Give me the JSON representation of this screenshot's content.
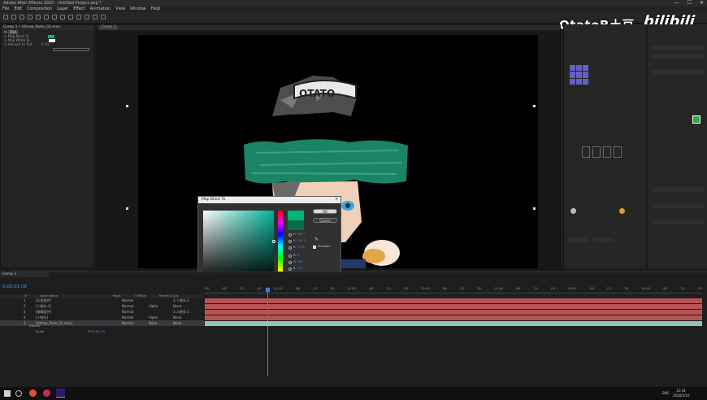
{
  "window": {
    "title": "Adobe After Effects 2020 - Untitled Project.aep *",
    "controls": [
      "—",
      "☐",
      "✕"
    ]
  },
  "menu": [
    "File",
    "Edit",
    "Composition",
    "Layer",
    "Effect",
    "Animation",
    "View",
    "Window",
    "Help"
  ],
  "viewer_tab": "Comp 1",
  "project_panel": {
    "header": "Comp 1 • Ultraw_Pude_02.mov",
    "effect": "Tint",
    "rows": [
      "Map Black To",
      "Map White To",
      "Amount to Tint"
    ],
    "value": "0.0%"
  },
  "watermark": {
    "channel": "OtatoB土豆",
    "site": "bilibili"
  },
  "dialog": {
    "title": "Map Black To",
    "ok": "OK",
    "cancel": "Cancel",
    "fields": [
      {
        "label": "H",
        "value": "163 °"
      },
      {
        "label": "S",
        "value": "100 %"
      },
      {
        "label": "B",
        "value": "71 %"
      },
      {
        "label": "R",
        "value": "0"
      },
      {
        "label": "G",
        "value": "181"
      },
      {
        "label": "B",
        "value": "120"
      }
    ],
    "hex": "00B578",
    "checkbox_label": "Previous",
    "colors": {
      "new": "#00b578",
      "old": "#0a6b4a"
    }
  },
  "timeline": {
    "timecode": "0:00:01:08",
    "col_headers": [
      "#",
      "Layer Name",
      "Mode",
      "T TrkMat",
      "Parent & Link"
    ],
    "layers": [
      {
        "num": "1",
        "name": "[头发组件]",
        "mode": "Normal",
        "trk": "",
        "parent": "3.人物头-2"
      },
      {
        "num": "2",
        "name": "[人物头-2]",
        "mode": "Normal",
        "trk": "Alpha",
        "parent": "None"
      },
      {
        "num": "3",
        "name": "[眼睛组件]",
        "mode": "Normal",
        "trk": "",
        "parent": "3.人物头-2"
      },
      {
        "num": "4",
        "name": "[人物头]",
        "mode": "Normal",
        "trk": "Alpha",
        "parent": "None"
      },
      {
        "num": "5",
        "name": "[Ultraw_Pude_02.mov]",
        "mode": "Normal",
        "trk": "None",
        "parent": "None"
      }
    ],
    "sublabels": [
      "Effects",
      "Scale"
    ],
    "scale_value": "83.0,83.0%",
    "ruler": [
      "00f",
      "06f",
      "12f",
      "18f",
      "01:00f",
      "06f",
      "12f",
      "18f",
      "02:00f",
      "06f",
      "12f",
      "18f",
      "03:00f",
      "06f",
      "12f",
      "18f",
      "04:00f",
      "06f",
      "12f",
      "18f",
      "05:00f",
      "06f",
      "12f",
      "18f",
      "06:00f",
      "06f",
      "12f",
      "18f"
    ]
  },
  "taskbar": {
    "time": "12:34",
    "date": "2020/5/10",
    "lang": "ENG"
  },
  "colors": {
    "track_red": "#b55456",
    "track_teal": "#8fc4bd",
    "accent_blue": "#2d8ceb",
    "ae_purple": "#2c1b6b"
  }
}
